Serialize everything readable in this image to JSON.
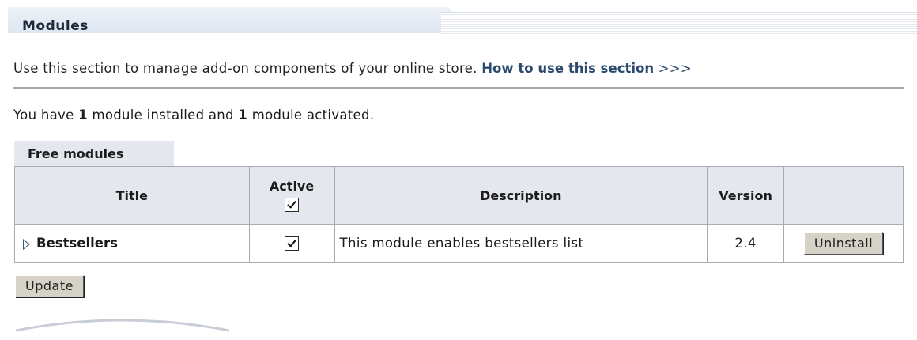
{
  "header": {
    "title": "Modules"
  },
  "intro": {
    "text": "Use this section to manage add-on components of your online store. ",
    "link_label": "How to use this section",
    "link_suffix": " >>>"
  },
  "status": {
    "prefix": "You have ",
    "installed_count": "1",
    "middle": " module installed and ",
    "activated_count": "1",
    "suffix": " module activated."
  },
  "group_tab": {
    "label": "Free modules"
  },
  "table": {
    "columns": {
      "title": "Title",
      "active": "Active",
      "description": "Description",
      "version": "Version"
    },
    "active_all_checked": true,
    "rows": [
      {
        "title": "Bestsellers",
        "active": true,
        "description": "This module enables bestsellers list",
        "version": "2.4",
        "action_label": "Uninstall"
      }
    ]
  },
  "update_label": "Update"
}
